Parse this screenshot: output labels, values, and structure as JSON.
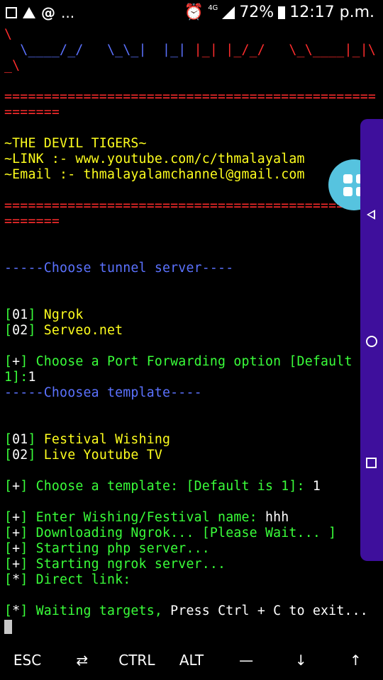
{
  "status_bar": {
    "overflow_indicator": "...",
    "network": "4G",
    "battery_percent": "72%",
    "time": "12:17 p.m."
  },
  "terminal": {
    "lines": [
      {
        "segments": [
          {
            "t": "\\",
            "c": "red"
          }
        ]
      },
      {
        "segments": [
          {
            "t": "  \\____/_/   \\_\\_|  |_| ",
            "c": "blue"
          },
          {
            "t": "|_| |_/_/   \\_\\____|_|\\",
            "c": "red"
          }
        ]
      },
      {
        "segments": [
          {
            "t": "_\\",
            "c": "red"
          }
        ]
      },
      {
        "segments": []
      },
      {
        "segments": [
          {
            "t": "===============================================",
            "c": "red"
          }
        ]
      },
      {
        "segments": [
          {
            "t": "=======",
            "c": "red"
          }
        ]
      },
      {
        "segments": []
      },
      {
        "segments": [
          {
            "t": "~THE DEVIL TIGERS~",
            "c": "yellow"
          }
        ]
      },
      {
        "segments": [
          {
            "t": "~LINK :- www.youtube.com/c/thmalayalam",
            "c": "yellow"
          }
        ]
      },
      {
        "segments": [
          {
            "t": "~Email :- thmalayalamchannel@gmail.com",
            "c": "yellow"
          }
        ]
      },
      {
        "segments": []
      },
      {
        "segments": [
          {
            "t": "===============================================",
            "c": "red"
          }
        ]
      },
      {
        "segments": [
          {
            "t": "=======",
            "c": "red"
          }
        ]
      },
      {
        "segments": []
      },
      {
        "segments": []
      },
      {
        "segments": [
          {
            "t": "-----Choose tunnel server----",
            "c": "blue"
          }
        ]
      },
      {
        "segments": []
      },
      {
        "segments": []
      },
      {
        "segments": [
          {
            "t": "[",
            "c": "green"
          },
          {
            "t": "01",
            "c": "white"
          },
          {
            "t": "] ",
            "c": "green"
          },
          {
            "t": "Ngrok",
            "c": "yellow"
          }
        ]
      },
      {
        "segments": [
          {
            "t": "[",
            "c": "green"
          },
          {
            "t": "02",
            "c": "white"
          },
          {
            "t": "] ",
            "c": "green"
          },
          {
            "t": "Serveo.net",
            "c": "yellow"
          }
        ]
      },
      {
        "segments": []
      },
      {
        "segments": [
          {
            "t": "[",
            "c": "green"
          },
          {
            "t": "+",
            "c": "white"
          },
          {
            "t": "] Choose a Port Forwarding option [Default is",
            "c": "green"
          }
        ]
      },
      {
        "segments": [
          {
            "t": "1]:",
            "c": "green"
          },
          {
            "t": "1",
            "c": "white"
          }
        ]
      },
      {
        "segments": [
          {
            "t": "-----Choosea template----",
            "c": "tblue"
          }
        ]
      },
      {
        "segments": []
      },
      {
        "segments": []
      },
      {
        "segments": [
          {
            "t": "[",
            "c": "green"
          },
          {
            "t": "01",
            "c": "white"
          },
          {
            "t": "] ",
            "c": "green"
          },
          {
            "t": "Festival Wishing",
            "c": "yellow"
          }
        ]
      },
      {
        "segments": [
          {
            "t": "[",
            "c": "green"
          },
          {
            "t": "02",
            "c": "white"
          },
          {
            "t": "] ",
            "c": "green"
          },
          {
            "t": "Live Youtube TV",
            "c": "yellow"
          }
        ]
      },
      {
        "segments": []
      },
      {
        "segments": [
          {
            "t": "[",
            "c": "green"
          },
          {
            "t": "+",
            "c": "white"
          },
          {
            "t": "] Choose a template: [Default is 1]: ",
            "c": "green"
          },
          {
            "t": "1",
            "c": "white"
          }
        ]
      },
      {
        "segments": []
      },
      {
        "segments": [
          {
            "t": "[",
            "c": "green"
          },
          {
            "t": "+",
            "c": "white"
          },
          {
            "t": "] Enter Wishing/Festival name: ",
            "c": "green"
          },
          {
            "t": "hhh",
            "c": "white"
          }
        ]
      },
      {
        "segments": [
          {
            "t": "[",
            "c": "green"
          },
          {
            "t": "+",
            "c": "white"
          },
          {
            "t": "] Downloading Ngrok... [Please Wait... ]",
            "c": "green"
          }
        ]
      },
      {
        "segments": [
          {
            "t": "[",
            "c": "green"
          },
          {
            "t": "+",
            "c": "white"
          },
          {
            "t": "] Starting php server...",
            "c": "green"
          }
        ]
      },
      {
        "segments": [
          {
            "t": "[",
            "c": "green"
          },
          {
            "t": "+",
            "c": "white"
          },
          {
            "t": "] Starting ngrok server...",
            "c": "green"
          }
        ]
      },
      {
        "segments": [
          {
            "t": "[",
            "c": "green"
          },
          {
            "t": "*",
            "c": "white"
          },
          {
            "t": "] Direct link:",
            "c": "green"
          }
        ]
      },
      {
        "segments": []
      },
      {
        "segments": [
          {
            "t": "[",
            "c": "green"
          },
          {
            "t": "*",
            "c": "white"
          },
          {
            "t": "] Waiting targets, ",
            "c": "green"
          },
          {
            "t": "Press Ctrl + C to exit...",
            "c": "white"
          }
        ]
      }
    ]
  },
  "extra_keys": [
    {
      "label": "ESC",
      "name": "esc-key"
    },
    {
      "label": "⇄",
      "name": "tab-key"
    },
    {
      "label": "CTRL",
      "name": "ctrl-key"
    },
    {
      "label": "ALT",
      "name": "alt-key"
    },
    {
      "label": "—",
      "name": "dash-key"
    },
    {
      "label": "↓",
      "name": "arrow-down-key"
    },
    {
      "label": "↑",
      "name": "arrow-up-key"
    }
  ],
  "colors": {
    "red": "#ff2d2d",
    "blue": "#5b72ff",
    "yellow": "#ffff1e",
    "green": "#3aff3a",
    "floating_button": "#56c3df",
    "side_nav": "#3e0f9c"
  },
  "icons": {
    "floating_button": "grid-apps-icon",
    "nav_back": "back-triangle-icon",
    "nav_home": "home-circle-icon",
    "nav_recent": "recent-square-icon"
  }
}
